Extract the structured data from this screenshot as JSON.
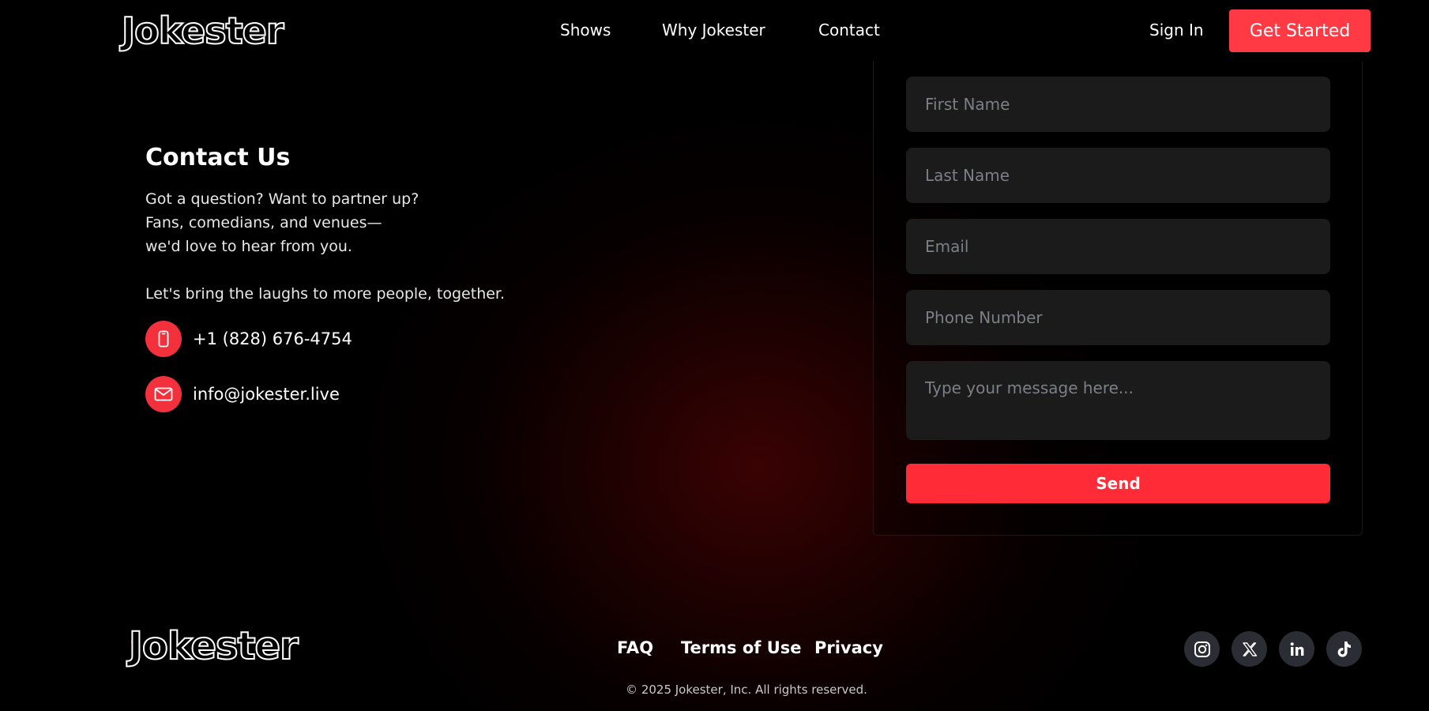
{
  "header": {
    "logo": "Jokester",
    "nav": [
      "Shows",
      "Why Jokester",
      "Contact"
    ],
    "sign_in": "Sign In",
    "get_started": "Get Started"
  },
  "contact": {
    "title": "Contact Us",
    "description_lines": [
      "Got a question? Want to partner up?",
      "Fans, comedians, and venues—",
      "we'd love to hear from you."
    ],
    "tagline": "Let's bring the laughs to more people, together.",
    "phone": "+1 (828) 676-4754",
    "phone_icon": "phone-icon",
    "email": "info@jokester.live",
    "email_icon": "mail-icon"
  },
  "form": {
    "first_name_placeholder": "First Name",
    "last_name_placeholder": "Last Name",
    "email_placeholder": "Email",
    "phone_placeholder": "Phone Number",
    "message_placeholder": "Type your message here...",
    "send_label": "Send"
  },
  "footer": {
    "logo": "Jokester",
    "links": [
      "FAQ",
      "Terms of Use",
      "Privacy"
    ],
    "social": [
      "instagram-icon",
      "x-icon",
      "linkedin-icon",
      "tiktok-icon"
    ],
    "copyright": "© 2025 Jokester, Inc. All rights reserved."
  },
  "colors": {
    "accent": "#ff2b36",
    "background": "#000000",
    "field": "#1b1b1c",
    "social_bg": "#2a2d33"
  }
}
